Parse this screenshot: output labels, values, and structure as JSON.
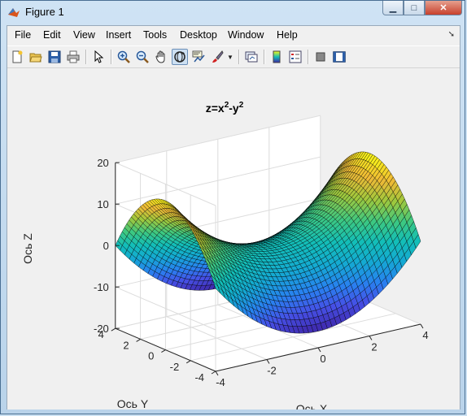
{
  "window": {
    "title": "Figure 1"
  },
  "menu": [
    "File",
    "Edit",
    "View",
    "Insert",
    "Tools",
    "Desktop",
    "Window",
    "Help"
  ],
  "toolbar_icons": [
    "new-figure-icon",
    "open-file-icon",
    "save-icon",
    "print-icon",
    "pointer-icon",
    "zoom-in-icon",
    "zoom-out-icon",
    "pan-icon",
    "rotate-3d-icon",
    "data-cursor-icon",
    "brush-icon",
    "brush-dropdown-icon",
    "link-plot-icon",
    "colorbar-icon",
    "legend-icon",
    "hide-plot-tools-icon",
    "show-plot-tools-icon"
  ],
  "chart_data": {
    "type": "surface",
    "title_base": "z=x",
    "title_exp1": "2",
    "title_mid": "-y",
    "title_exp2": "2",
    "xlabel": "Ось X",
    "ylabel": "Ось Y",
    "zlabel": "Ось Z",
    "function": "z = x^2 - y^2",
    "xlim": [
      -4,
      4
    ],
    "ylim": [
      -4,
      4
    ],
    "zlim": [
      -20,
      20
    ],
    "xticks": [
      -4,
      -2,
      0,
      2,
      4
    ],
    "yticks": [
      -4,
      -2,
      0,
      2,
      4
    ],
    "zticks": [
      -20,
      -10,
      0,
      10,
      20
    ],
    "grid": true,
    "colormap": "parula",
    "corner_values": [
      {
        "x": -4,
        "y": -4,
        "z": 0
      },
      {
        "x": 4,
        "y": -4,
        "z": 0
      },
      {
        "x": 4,
        "y": 4,
        "z": 0
      },
      {
        "x": -4,
        "y": 4,
        "z": 0
      },
      {
        "x": 0,
        "y": -4,
        "z": -16
      },
      {
        "x": 0,
        "y": 4,
        "z": -16
      },
      {
        "x": -4,
        "y": 0,
        "z": 16
      },
      {
        "x": 4,
        "y": 0,
        "z": 16
      }
    ]
  }
}
